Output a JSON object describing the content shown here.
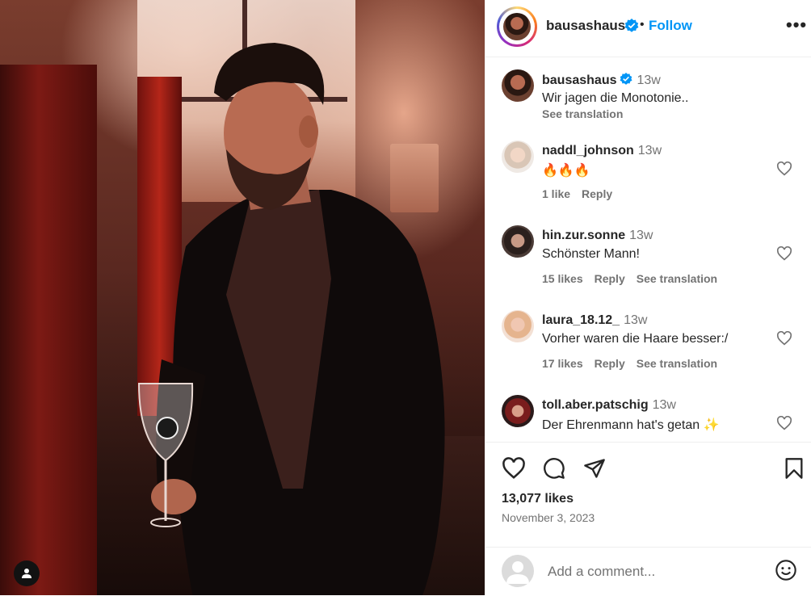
{
  "post": {
    "author": "bausashaus",
    "follow_label": "Follow",
    "separator": "•",
    "more_label": "•••"
  },
  "caption": {
    "username": "bausashaus",
    "time": "13w",
    "text": "Wir jagen die Monotonie..",
    "translate_label": "See translation"
  },
  "comments": [
    {
      "username": "naddl_johnson",
      "time": "13w",
      "text": "🔥🔥🔥",
      "likes": "1 like",
      "reply": "Reply",
      "translate": ""
    },
    {
      "username": "hin.zur.sonne",
      "time": "13w",
      "text": "Schönster Mann!",
      "likes": "15 likes",
      "reply": "Reply",
      "translate": "See translation"
    },
    {
      "username": "laura_18.12_",
      "time": "13w",
      "text": "Vorher waren die Haare besser:/",
      "likes": "17 likes",
      "reply": "Reply",
      "translate": "See translation"
    },
    {
      "username": "toll.aber.patschig",
      "time": "13w",
      "text": "Der Ehrenmann hat's getan ✨",
      "likes": "",
      "reply": "",
      "translate": ""
    }
  ],
  "stats": {
    "likes": "13,077 likes",
    "date": "November 3, 2023"
  },
  "composer": {
    "placeholder": "Add a comment..."
  },
  "colors": {
    "follow": "#0095f6",
    "verified": "#0095f6",
    "muted": "#737373"
  },
  "icons": [
    "verified-badge-icon",
    "more-options-icon",
    "heart-icon",
    "comment-icon",
    "share-icon",
    "bookmark-icon",
    "emoji-icon",
    "user-tag-icon"
  ]
}
